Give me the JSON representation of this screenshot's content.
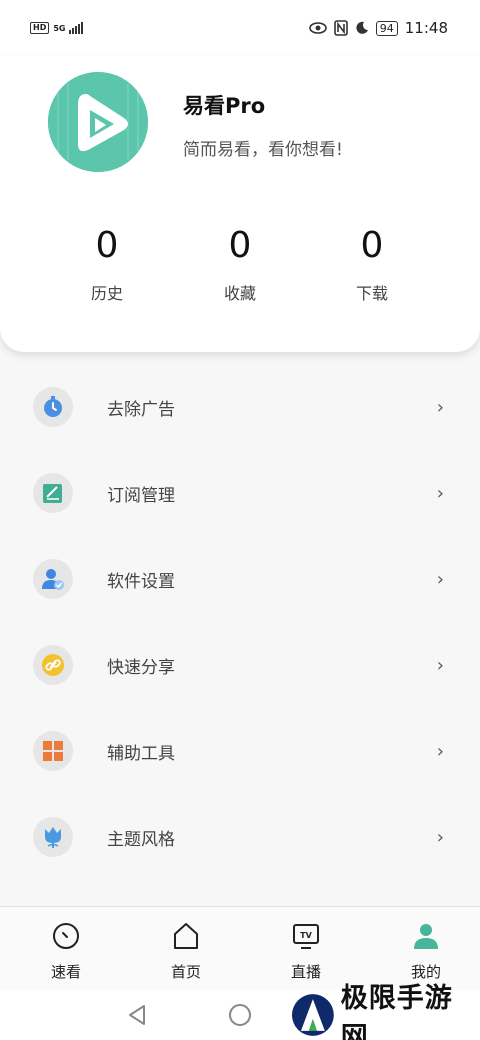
{
  "status_bar": {
    "network_badge": "HD",
    "network_type": "5G",
    "battery": "94",
    "time": "11:48"
  },
  "profile": {
    "app_name": "易看Pro",
    "motto": "简而易看，看你想看!",
    "stats": [
      {
        "count": "0",
        "label": "历史"
      },
      {
        "count": "0",
        "label": "收藏"
      },
      {
        "count": "0",
        "label": "下载"
      }
    ]
  },
  "menu": {
    "items": [
      {
        "label": "去除广告",
        "icon": "timer-icon",
        "color": "#4a8fe0"
      },
      {
        "label": "订阅管理",
        "icon": "subscribe-note-icon",
        "color": "#3fae93"
      },
      {
        "label": "软件设置",
        "icon": "user-settings-icon",
        "color": "#3f87e0"
      },
      {
        "label": "快速分享",
        "icon": "link-share-icon",
        "color": "#f2c12e"
      },
      {
        "label": "辅助工具",
        "icon": "grid-tools-icon",
        "color": "#ec7a3a"
      },
      {
        "label": "主题风格",
        "icon": "tulip-theme-icon",
        "color": "#4a9ae0"
      }
    ],
    "chevron": "›"
  },
  "bottom_nav": {
    "items": [
      {
        "label": "速看",
        "icon": "clock-icon"
      },
      {
        "label": "首页",
        "icon": "home-icon"
      },
      {
        "label": "直播",
        "icon": "tv-icon"
      },
      {
        "label": "我的",
        "icon": "user-icon",
        "active_color": "#47b59b"
      }
    ]
  },
  "watermark": {
    "text": "极限手游网"
  }
}
